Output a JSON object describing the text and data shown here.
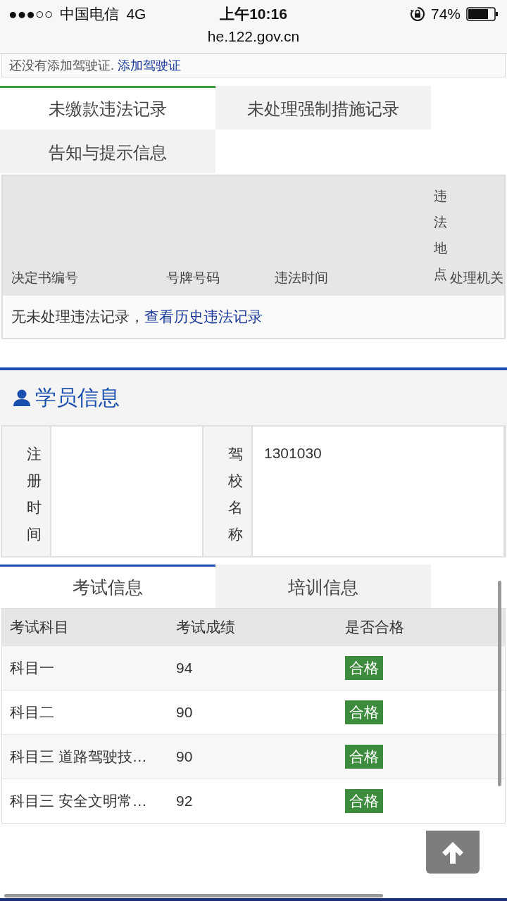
{
  "status_bar": {
    "signal": "●●●○○",
    "carrier": "中国电信",
    "network": "4G",
    "time": "上午10:16",
    "battery_percent": "74%"
  },
  "address_bar": {
    "url": "he.122.gov.cn"
  },
  "license_notice": {
    "text": "还没有添加驾驶证.",
    "link": "添加驾驶证"
  },
  "violation_tabs": [
    {
      "label": "未缴款违法记录",
      "selected": true
    },
    {
      "label": "未处理强制措施记录",
      "selected": false
    },
    {
      "label": "告知与提示信息",
      "selected": false
    }
  ],
  "violation_table": {
    "columns": [
      "决定书编号",
      "号牌号码",
      "违法时间",
      "违法地点",
      "处理机关"
    ],
    "empty_message": "无未处理违法记录，",
    "history_link": "查看历史违法记录"
  },
  "student_section": {
    "title": "学员信息",
    "fields": [
      {
        "label": "注册时间"
      },
      {
        "label": "驾校名称",
        "value": "1301030"
      }
    ]
  },
  "exam_tabs": [
    {
      "label": "考试信息",
      "selected": true
    },
    {
      "label": "培训信息",
      "selected": false
    }
  ],
  "exam_table": {
    "columns": [
      "考试科目",
      "考试成绩",
      "是否合格"
    ],
    "rows": [
      {
        "subject": "科目一",
        "score": "94",
        "result": "合格"
      },
      {
        "subject": "科目二",
        "score": "90",
        "result": "合格"
      },
      {
        "subject": "科目三 道路驾驶技…",
        "score": "90",
        "result": "合格"
      },
      {
        "subject": "科目三 安全文明常…",
        "score": "92",
        "result": "合格"
      }
    ]
  }
}
